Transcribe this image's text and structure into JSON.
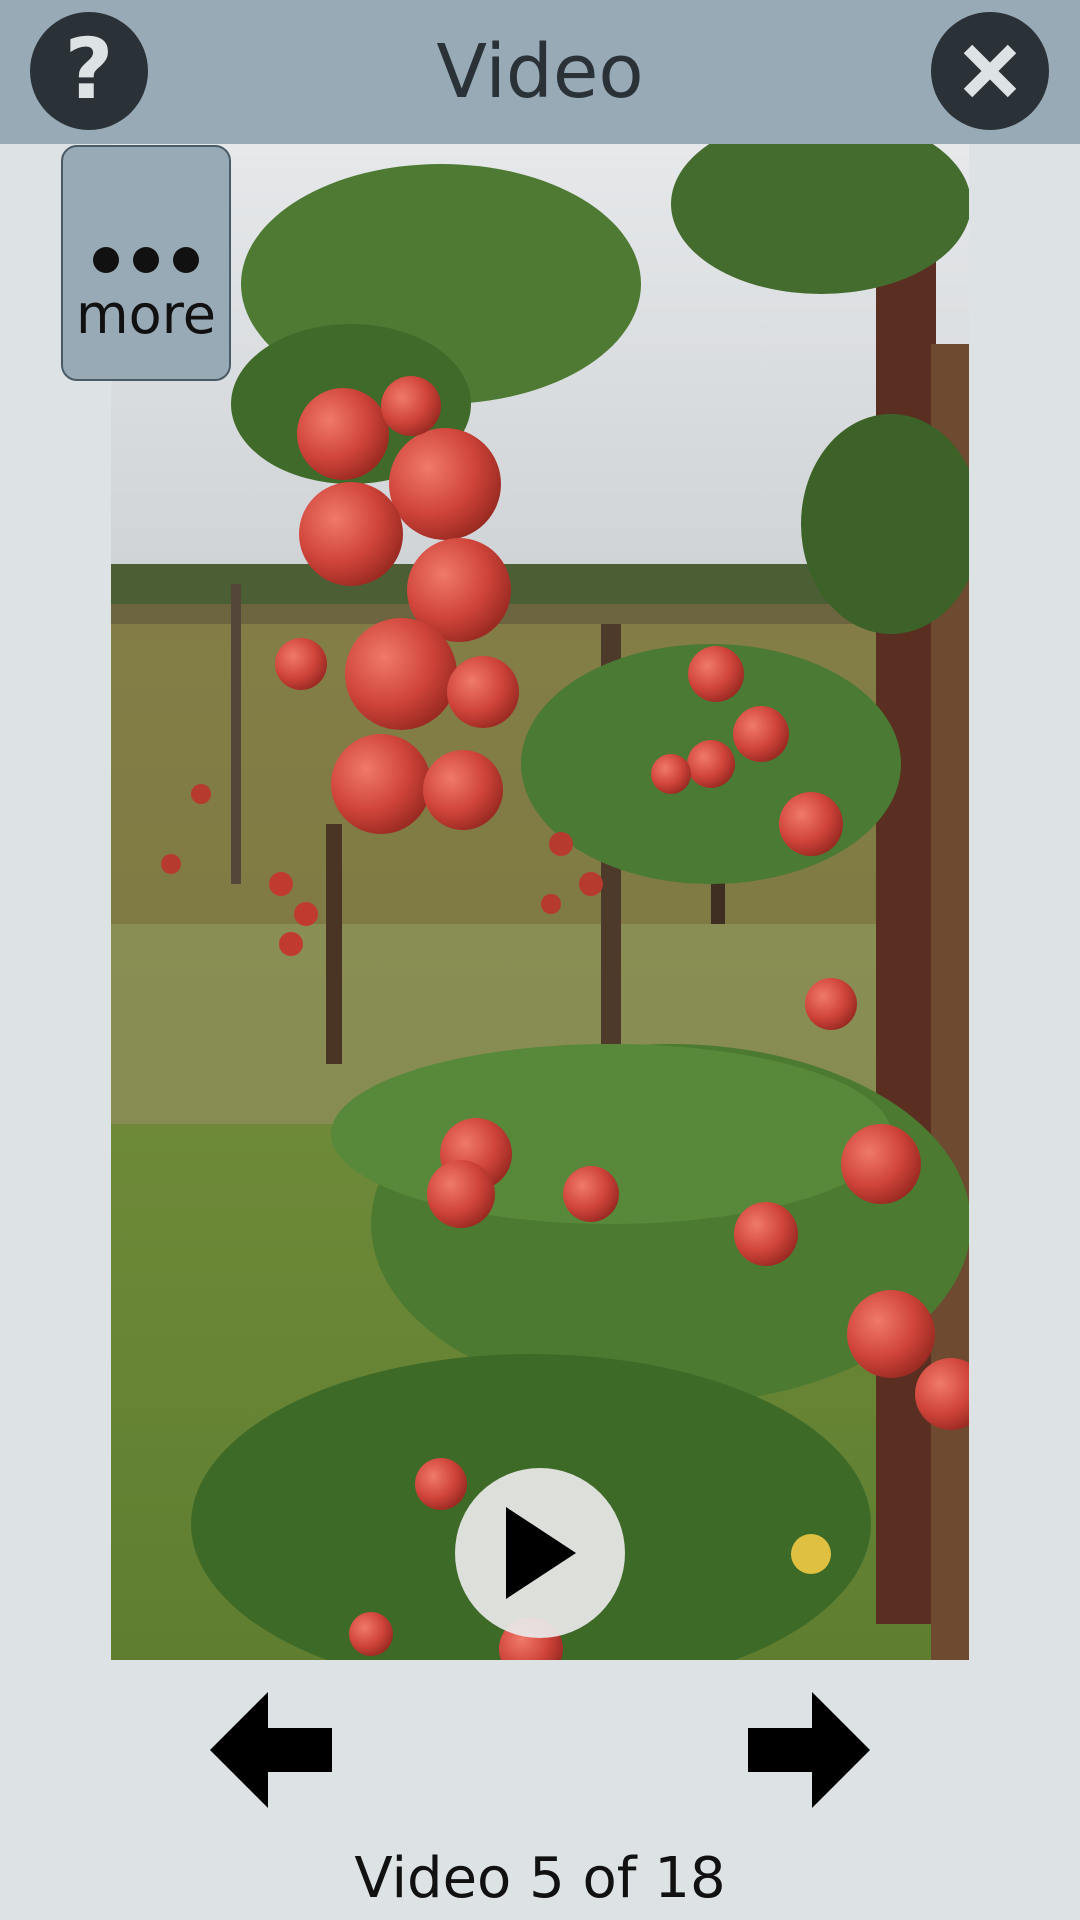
{
  "header": {
    "title": "Video",
    "help_symbol": "?",
    "help_icon": "question-mark-icon",
    "close_icon": "close-x-icon"
  },
  "menu": {
    "more_label": "more",
    "more_icon": "ellipsis-icon"
  },
  "player": {
    "play_icon": "play-icon",
    "thumbnail_description_icon": "apple-orchard-video-frame"
  },
  "navigation": {
    "prev_icon": "arrow-left-icon",
    "next_icon": "arrow-right-icon",
    "counter": "Video 5 of 18"
  },
  "colors": {
    "background": "#dde3e5",
    "header": "#98aab6",
    "button_dark": "#2a3238"
  }
}
